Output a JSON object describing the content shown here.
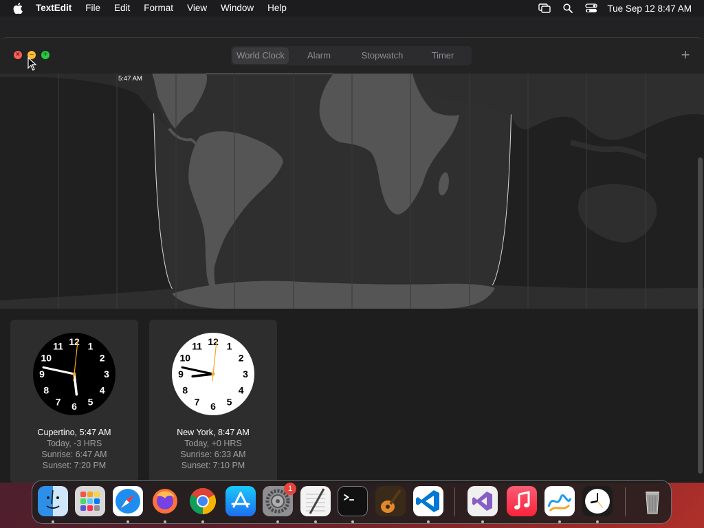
{
  "menubar": {
    "app_name": "TextEdit",
    "items": [
      "File",
      "Edit",
      "Format",
      "View",
      "Window",
      "Help"
    ],
    "datetime": "Tue Sep 12  8:47 AM",
    "status_icons": [
      "screen-mirroring-icon",
      "search-icon",
      "control-center-icon"
    ]
  },
  "window": {
    "traffic_lights": {
      "close": "×",
      "minimize": "–",
      "zoom": "+"
    },
    "tabs": [
      {
        "label": "World Clock",
        "active": true
      },
      {
        "label": "Alarm",
        "active": false
      },
      {
        "label": "Stopwatch",
        "active": false
      },
      {
        "label": "Timer",
        "active": false
      }
    ],
    "add_button": "+",
    "map": {
      "time_label": "5:47 AM"
    },
    "clocks": [
      {
        "city_time": "Cupertino, 5:47 AM",
        "offset": "Today, -3 HRS",
        "sunrise": "Sunrise: 6:47 AM",
        "sunset": "Sunset: 7:20 PM",
        "theme": "dark",
        "hour": 5,
        "minute": 47,
        "second": 1
      },
      {
        "city_time": "New York, 8:47 AM",
        "offset": "Today, +0 HRS",
        "sunrise": "Sunrise: 6:33 AM",
        "sunset": "Sunset: 7:10 PM",
        "theme": "light",
        "hour": 8,
        "minute": 47,
        "second": 1
      }
    ]
  },
  "dock": {
    "apps": [
      "finder-icon",
      "launchpad-icon",
      "safari-icon",
      "firefox-icon",
      "chrome-icon",
      "app-store-icon",
      "system-settings-icon",
      "textedit-icon",
      "terminal-icon",
      "garageband-icon",
      "vscode-icon",
      "visual-studio-icon",
      "music-icon",
      "freeform-icon",
      "clock-icon",
      "trash-icon"
    ],
    "settings_badge": "1"
  },
  "colors": {
    "accent_close": "#fe5f57",
    "accent_minimize": "#febc2e",
    "accent_zoom": "#28c840",
    "second_hand": "#f5a623"
  }
}
